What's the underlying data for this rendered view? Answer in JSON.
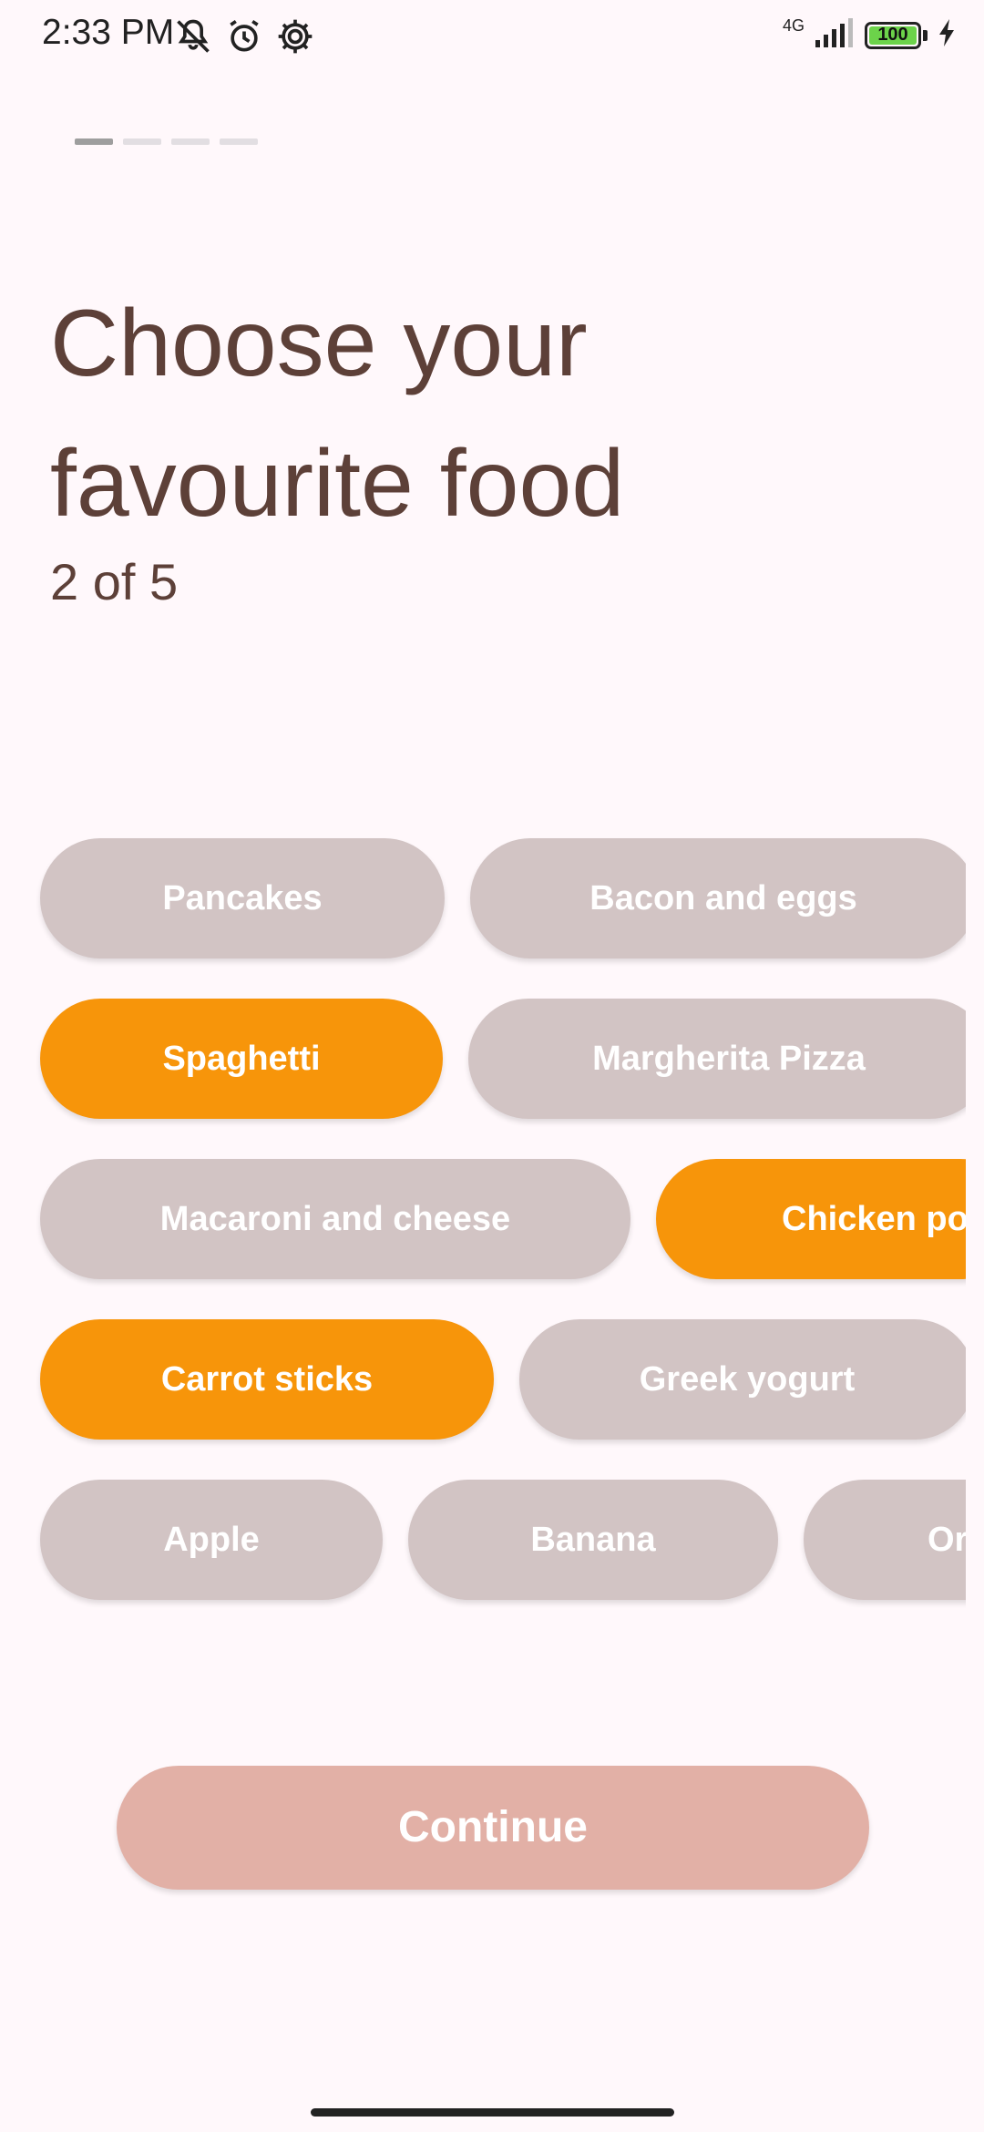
{
  "status_bar": {
    "time": "2:33 PM",
    "network": "4G",
    "battery": "100",
    "icons": [
      "mute-icon",
      "alarm-icon",
      "settings-icon",
      "signal-icon",
      "battery-icon",
      "charging-icon"
    ]
  },
  "progress": {
    "current_step": 1,
    "total_steps": 4
  },
  "title": "Choose your favourite food",
  "subtitle": "2 of 5",
  "foods": [
    {
      "label": "Pancakes",
      "selected": false
    },
    {
      "label": "Bacon and eggs",
      "selected": false
    },
    {
      "label": "Spaghetti",
      "selected": true
    },
    {
      "label": "Margherita Pizza",
      "selected": false
    },
    {
      "label": "Macaroni and cheese",
      "selected": false
    },
    {
      "label": "Chicken pot",
      "selected": true
    },
    {
      "label": "Carrot sticks",
      "selected": true
    },
    {
      "label": "Greek yogurt",
      "selected": false
    },
    {
      "label": "Apple",
      "selected": false
    },
    {
      "label": "Banana",
      "selected": false
    },
    {
      "label": "Or",
      "selected": false
    }
  ],
  "continue_label": "Continue",
  "colors": {
    "selected": "#F7950A",
    "unselected": "#D2C4C4",
    "continue_disabled": "#E2B0A6",
    "title": "#5D4038"
  }
}
